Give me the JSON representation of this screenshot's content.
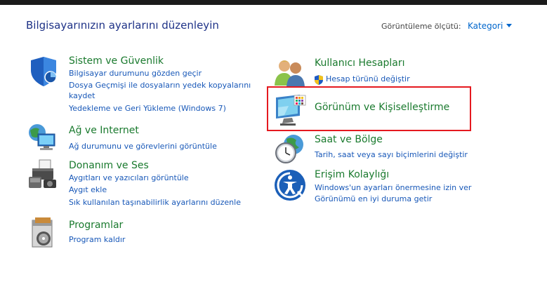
{
  "header": {
    "title": "Bilgisayarınızın ayarlarını düzenleyin",
    "view_by_label": "Görüntüleme ölçütü:",
    "view_by_value": "Kategori"
  },
  "categories": {
    "system": {
      "title": "Sistem ve Güvenlik",
      "links": [
        "Bilgisayar durumunu gözden geçir",
        "Dosya Geçmişi ile dosyaların yedek kopyalarını",
        "kaydet",
        "Yedekleme ve Geri Yükleme (Windows 7)"
      ]
    },
    "network": {
      "title": "Ağ ve Internet",
      "links": [
        "Ağ durumunu ve görevlerini görüntüle"
      ]
    },
    "hardware": {
      "title": "Donanım ve Ses",
      "links": [
        "Aygıtları ve yazıcıları görüntüle",
        "Aygıt ekle",
        "Sık kullanılan taşınabilirlik ayarlarını düzenle"
      ]
    },
    "programs": {
      "title": "Programlar",
      "links": [
        "Program kaldır"
      ]
    },
    "users": {
      "title": "Kullanıcı Hesapları",
      "links": [
        "Hesap türünü değiştir"
      ]
    },
    "appearance": {
      "title": "Görünüm ve Kişiselleştirme"
    },
    "clock": {
      "title": "Saat ve Bölge",
      "links": [
        "Tarih, saat veya sayı biçimlerini değiştir"
      ]
    },
    "ease": {
      "title": "Erişim Kolaylığı",
      "links": [
        "Windows'un ayarları önermesine izin ver",
        "Görünümü en iyi duruma getir"
      ]
    }
  },
  "colors": {
    "title_green": "#1a7a2e",
    "link_blue": "#1858b8",
    "highlight_red": "#e5191f"
  }
}
